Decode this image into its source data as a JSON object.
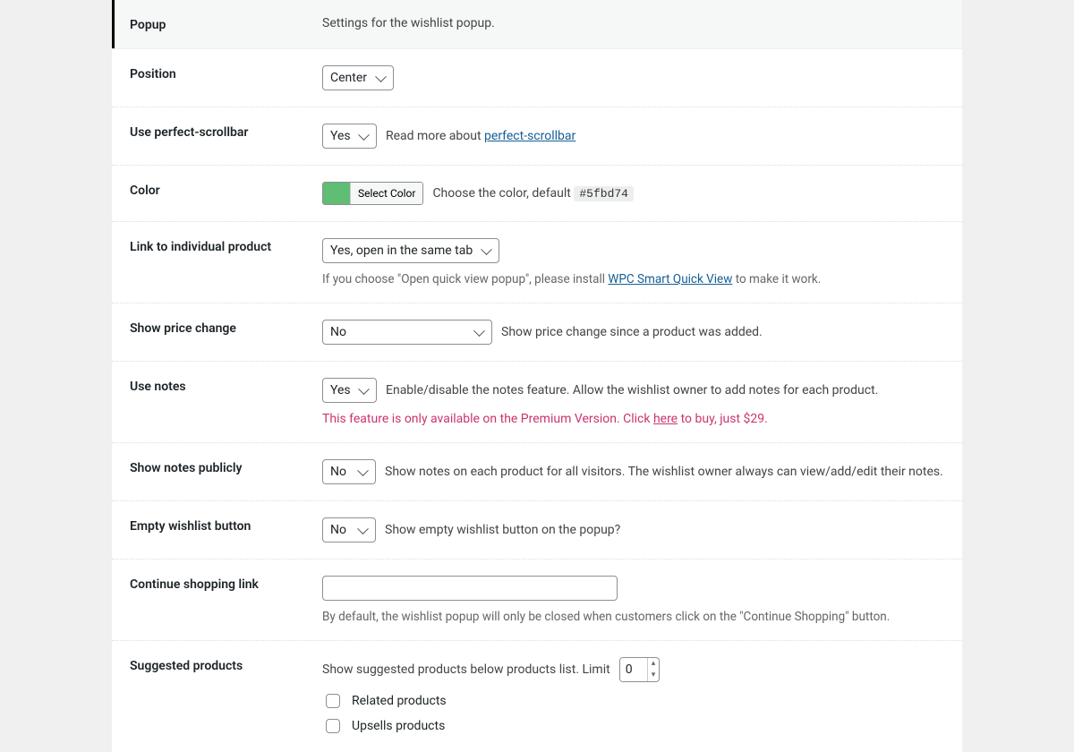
{
  "section": {
    "title": "Popup",
    "desc": "Settings for the wishlist popup."
  },
  "position": {
    "label": "Position",
    "value": "Center"
  },
  "scrollbar": {
    "label": "Use perfect-scrollbar",
    "value": "Yes",
    "desc_prefix": "Read more about ",
    "link": "perfect-scrollbar"
  },
  "color": {
    "label": "Color",
    "button": "Select Color",
    "swatch": "#5fbd74",
    "desc_prefix": "Choose the color, default ",
    "code": "#5fbd74"
  },
  "link_product": {
    "label": "Link to individual product",
    "value": "Yes, open in the same tab",
    "help_prefix": "If you choose \"Open quick view popup\", please install ",
    "help_link": "WPC Smart Quick View",
    "help_suffix": " to make it work."
  },
  "price_change": {
    "label": "Show price change",
    "value": "No",
    "desc": "Show price change since a product was added."
  },
  "use_notes": {
    "label": "Use notes",
    "value": "Yes",
    "desc": "Enable/disable the notes feature. Allow the wishlist owner to add notes for each product.",
    "premium_prefix": "This feature is only available on the Premium Version. Click ",
    "premium_link": "here",
    "premium_suffix": " to buy, just $29."
  },
  "notes_public": {
    "label": "Show notes publicly",
    "value": "No",
    "desc": "Show notes on each product for all visitors. The wishlist owner always can view/add/edit their notes."
  },
  "empty_btn": {
    "label": "Empty wishlist button",
    "value": "No",
    "desc": "Show empty wishlist button on the popup?"
  },
  "continue": {
    "label": "Continue shopping link",
    "value": "",
    "help": "By default, the wishlist popup will only be closed when customers click on the \"Continue Shopping\" button."
  },
  "suggested": {
    "label": "Suggested products",
    "desc_prefix": "Show suggested products below products list. Limit",
    "limit": "0",
    "options": [
      {
        "label": "Related products"
      },
      {
        "label": "Upsells products"
      }
    ]
  }
}
